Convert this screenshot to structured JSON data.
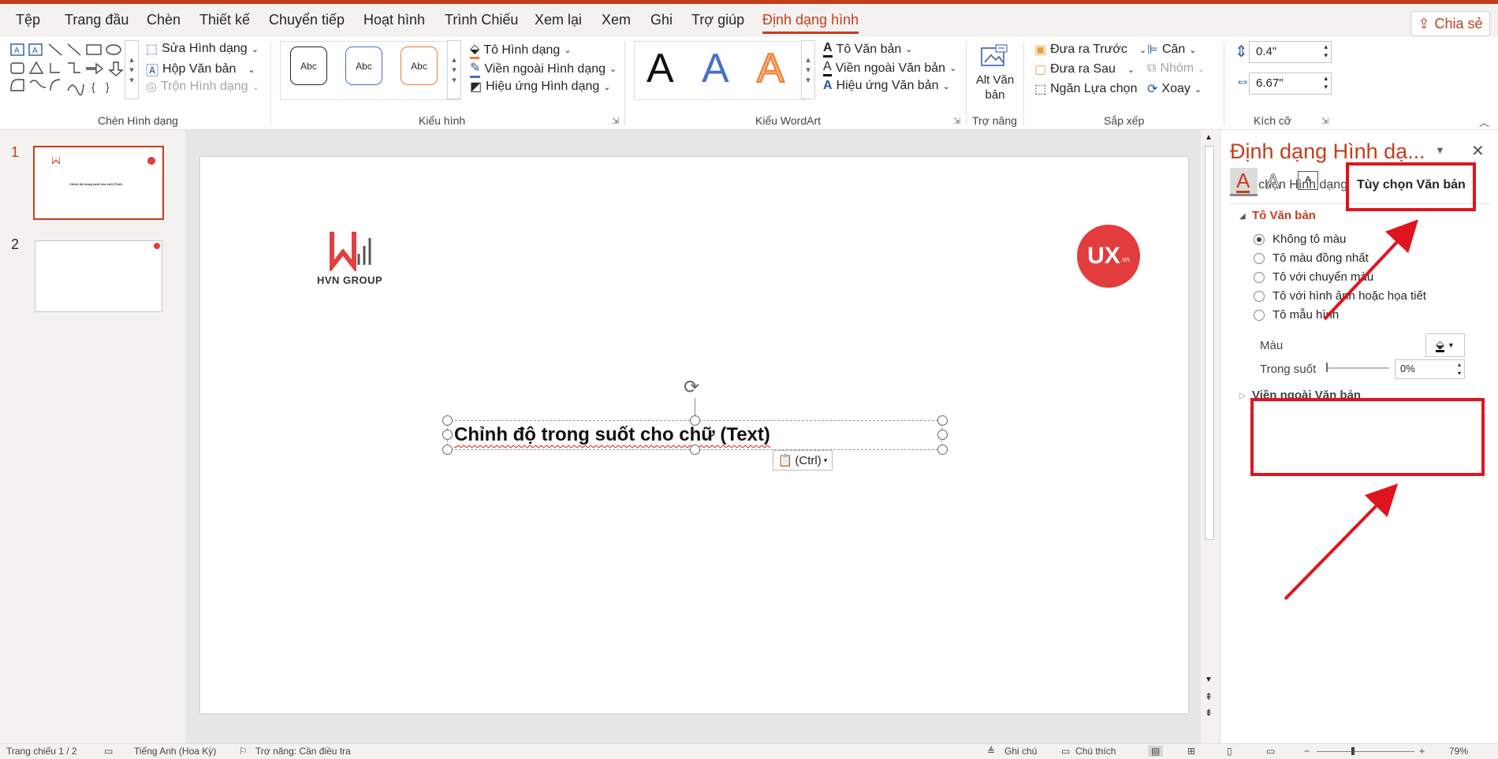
{
  "menu_tabs": [
    "Tệp",
    "Trang đầu",
    "Chèn",
    "Thiết kế",
    "Chuyển tiếp",
    "Hoạt hình",
    "Trình Chiếu",
    "Xem lại",
    "Xem",
    "Ghi",
    "Trợ giúp",
    "Định dạng hình"
  ],
  "share_label": "Chia sẻ",
  "ribbon": {
    "insert_shapes": {
      "edit_shape": "Sửa Hình dạng",
      "text_box": "Hộp Văn bản",
      "merge_shapes": "Trộn Hình dạng",
      "group_label": "Chèn Hình dạng"
    },
    "shape_styles": {
      "samples": [
        "Abc",
        "Abc",
        "Abc"
      ],
      "fill": "Tô Hình dạng",
      "outline": "Viền ngoài Hình dạng",
      "effects": "Hiệu ứng Hình dạng",
      "group_label": "Kiểu hình"
    },
    "wordart": {
      "samples": [
        "A",
        "A",
        "A"
      ],
      "fill": "Tô Văn bản",
      "outline": "Viền ngoài Văn bản",
      "effects": "Hiệu ứng Văn bản",
      "group_label": "Kiểu WordArt"
    },
    "accessibility": {
      "alt_text": "Alt Văn bản",
      "group_label": "Trợ năng"
    },
    "arrange": {
      "bring_forward": "Đưa ra Trước",
      "send_backward": "Đưa ra Sau",
      "selection_pane": "Ngăn Lựa chọn",
      "align": "Căn",
      "group": "Nhóm",
      "rotate": "Xoay",
      "group_label": "Sắp xếp"
    },
    "size": {
      "height": "0.4\"",
      "width": "6.67\"",
      "group_label": "Kích cỡ"
    }
  },
  "thumbnails": [
    {
      "number": "1",
      "text": "Chỉnh độ trong suốt cho chữ (Text)"
    },
    {
      "number": "2"
    }
  ],
  "slide": {
    "logo_left": "HVN GROUP",
    "logo_right_main": "UX",
    "logo_right_sub": ".vn",
    "text": "Chỉnh độ trong suốt cho chữ (Text)",
    "paste_options": "(Ctrl)"
  },
  "pane": {
    "title": "Định dạng Hình dạ...",
    "tab_shape": "Tùy chọn Hình dạng",
    "tab_text": "Tùy chọn Văn bản",
    "section_fill": "Tô Văn bản",
    "options": [
      "Không tô màu",
      "Tô màu đồng nhất",
      "Tô với chuyển màu",
      "Tô với hình ảnh hoặc họa tiết",
      "Tô mẫu hình"
    ],
    "color_label": "Màu",
    "transparency_label": "Trong suốt",
    "transparency_value": "0%",
    "section_outline": "Viền ngoài Văn bản"
  },
  "status": {
    "slide": "Trang chiếu 1 / 2",
    "language": "Tiếng Anh (Hoa Kỳ)",
    "accessibility": "Trợ năng: Cần điều tra",
    "notes": "Ghi chú",
    "comments": "Chú thích",
    "zoom": "79%"
  },
  "colors": {
    "accent": "#c43e1c",
    "annotation": "#e0141e"
  }
}
